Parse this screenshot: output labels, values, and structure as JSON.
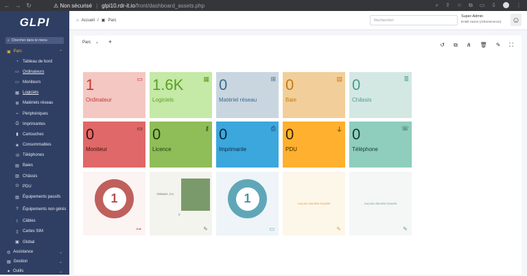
{
  "browser": {
    "security_label": "Non sécurisé",
    "url_host": "glpi10.rdr-it.io",
    "url_path": "/front/dashboard_assets.php"
  },
  "sidebar": {
    "logo": "GLPI",
    "search_label": "Chercher dans le menu",
    "active_section": "Parc",
    "items": [
      {
        "label": "Tableau de bord",
        "icon": "dashboard-icon"
      },
      {
        "label": "Ordinateurs",
        "icon": "computer-icon"
      },
      {
        "label": "Moniteurs",
        "icon": "monitor-icon"
      },
      {
        "label": "Logiciels",
        "icon": "software-icon"
      },
      {
        "label": "Matériels réseau",
        "icon": "network-icon"
      },
      {
        "label": "Périphériques",
        "icon": "peripheral-icon"
      },
      {
        "label": "Imprimantes",
        "icon": "printer-icon"
      },
      {
        "label": "Cartouches",
        "icon": "cartridge-icon"
      },
      {
        "label": "Consommables",
        "icon": "consumable-icon"
      },
      {
        "label": "Téléphones",
        "icon": "phone-icon"
      },
      {
        "label": "Baies",
        "icon": "rack-icon"
      },
      {
        "label": "Châssis",
        "icon": "enclosure-icon"
      },
      {
        "label": "PDU",
        "icon": "pdu-icon"
      },
      {
        "label": "Équipements passifs",
        "icon": "passive-icon"
      },
      {
        "label": "Équipements non gérés",
        "icon": "unmanaged-icon"
      },
      {
        "label": "Câbles",
        "icon": "cable-icon"
      },
      {
        "label": "Cartes SIM",
        "icon": "sim-icon"
      },
      {
        "label": "Global",
        "icon": "global-icon"
      }
    ],
    "sections": [
      "Assistance",
      "Gestion",
      "Outils"
    ]
  },
  "header": {
    "breadcrumb_home": "Accueil",
    "breadcrumb_current": "Parc",
    "search_placeholder": "Rechercher",
    "user_name": "Super-Admin",
    "user_entity": "Entité racine (Arborescence)"
  },
  "dashboard": {
    "selected": "Parc",
    "cards": [
      {
        "value": "1",
        "label": "Ordinateur",
        "bg": "#f4c7c3",
        "fg": "#c0392b",
        "icon": "laptop-icon"
      },
      {
        "value": "1.6K",
        "label": "Logiciels",
        "bg": "#c5e9a6",
        "fg": "#5a9e23",
        "icon": "apps-icon"
      },
      {
        "value": "0",
        "label": "Matériel réseau",
        "bg": "#c9d6e0",
        "fg": "#3b6b8c",
        "icon": "network-icon"
      },
      {
        "value": "0",
        "label": "Baie",
        "bg": "#f2cf9a",
        "fg": "#c77a10",
        "icon": "rack-icon"
      },
      {
        "value": "0",
        "label": "Châssis",
        "bg": "#d3e8e3",
        "fg": "#4f9a8a",
        "icon": "enclosure-icon"
      },
      {
        "value": "0",
        "label": "Moniteur",
        "bg": "#e06868",
        "fg": "#3a1010",
        "icon": "monitor-icon"
      },
      {
        "value": "0",
        "label": "Licence",
        "bg": "#8fbd58",
        "fg": "#1f3a0a",
        "icon": "key-icon"
      },
      {
        "value": "0",
        "label": "Imprimante",
        "bg": "#3ba7dd",
        "fg": "#0b2a3d",
        "icon": "printer-icon"
      },
      {
        "value": "0",
        "label": "PDU",
        "bg": "#ffb02e",
        "fg": "#3a2300",
        "icon": "plug-icon"
      },
      {
        "value": "0",
        "label": "Téléphone",
        "bg": "#8fcdbd",
        "fg": "#133a30",
        "icon": "phone-icon"
      }
    ],
    "widgets": {
      "donut1": {
        "value": "1",
        "ring": "#c0605d",
        "text": "#b0504d"
      },
      "vendor": {
        "label": "VMware, Inc.",
        "value": "0"
      },
      "donut2": {
        "value": "1",
        "ring": "#5fa7b8",
        "text": "#4a93a6"
      },
      "nodata1": "Aucune donnée trouvée",
      "nodata2": "Aucune donnée trouvée"
    }
  }
}
